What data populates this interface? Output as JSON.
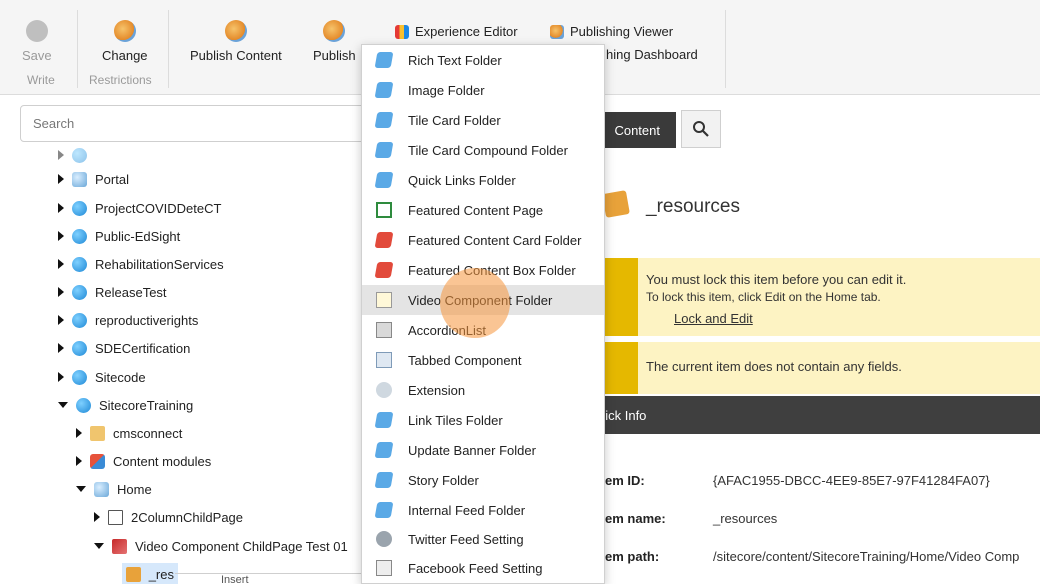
{
  "ribbon": {
    "save_label": "Save",
    "write_group": "Write",
    "change_label": "Change",
    "restrictions_group": "Restrictions",
    "publish_content_label": "Publish Content",
    "publish_label": "Publish",
    "experience_editor_label": "Experience Editor",
    "publishing_viewer_label": "Publishing Viewer",
    "publishing_dashboard_label": "hing Dashboard"
  },
  "search": {
    "placeholder": "Search"
  },
  "tree": {
    "items": [
      {
        "label": "Portal"
      },
      {
        "label": "ProjectCOVIDDeteCT"
      },
      {
        "label": "Public-EdSight"
      },
      {
        "label": "RehabilitationServices"
      },
      {
        "label": "ReleaseTest"
      },
      {
        "label": "reproductiverights"
      },
      {
        "label": "SDECertification"
      },
      {
        "label": "Sitecode"
      },
      {
        "label": "SitecoreTraining"
      },
      {
        "label": "cmsconnect"
      },
      {
        "label": "Content modules"
      },
      {
        "label": "Home"
      },
      {
        "label": "2ColumnChildPage"
      },
      {
        "label": "Video Component ChildPage Test 01"
      },
      {
        "label": "_res"
      }
    ]
  },
  "content_tabs": {
    "content_label": "Content"
  },
  "item": {
    "title": "_resources"
  },
  "warnings": {
    "lock_title": "You must lock this item before you can edit it.",
    "lock_hint": "To lock this item, click Edit on the Home tab.",
    "lock_link": "Lock and Edit",
    "no_fields": "The current item does not contain any fields."
  },
  "quick_info": {
    "header": "uick Info",
    "id_label": "em ID:",
    "id_value": "{AFAC1955-DBCC-4EE9-85E7-97F41284FA07}",
    "name_label": "em name:",
    "name_value": "_resources",
    "path_label": "em path:",
    "path_value": "/sitecore/content/SitecoreTraining/Home/Video Comp"
  },
  "menu": {
    "items": [
      {
        "label": "Rich Text Folder",
        "icon": "folder-blue-icon"
      },
      {
        "label": "Image Folder",
        "icon": "folder-blue-icon"
      },
      {
        "label": "Tile Card Folder",
        "icon": "folder-blue-icon"
      },
      {
        "label": "Tile Card Compound Folder",
        "icon": "folder-blue-icon"
      },
      {
        "label": "Quick Links Folder",
        "icon": "folder-blue-icon"
      },
      {
        "label": "Featured Content Page",
        "icon": "page-green-icon"
      },
      {
        "label": "Featured Content Card Folder",
        "icon": "folder-red-icon"
      },
      {
        "label": "Featured Content Box Folder",
        "icon": "folder-red-icon"
      },
      {
        "label": "Video Component Folder",
        "icon": "document-icon"
      },
      {
        "label": "AccordionList",
        "icon": "accordion-icon"
      },
      {
        "label": "Tabbed Component",
        "icon": "tabbed-icon"
      },
      {
        "label": "Extension",
        "icon": "extension-icon"
      },
      {
        "label": "Link Tiles Folder",
        "icon": "folder-blue-icon"
      },
      {
        "label": "Update Banner Folder",
        "icon": "folder-blue-icon"
      },
      {
        "label": "Story Folder",
        "icon": "folder-blue-icon"
      },
      {
        "label": "Internal Feed Folder",
        "icon": "folder-blue-icon"
      },
      {
        "label": "Twitter Feed Setting",
        "icon": "gear-icon"
      },
      {
        "label": "Facebook Feed Setting",
        "icon": "sheet-icon"
      }
    ]
  },
  "context_hint": "Insert"
}
